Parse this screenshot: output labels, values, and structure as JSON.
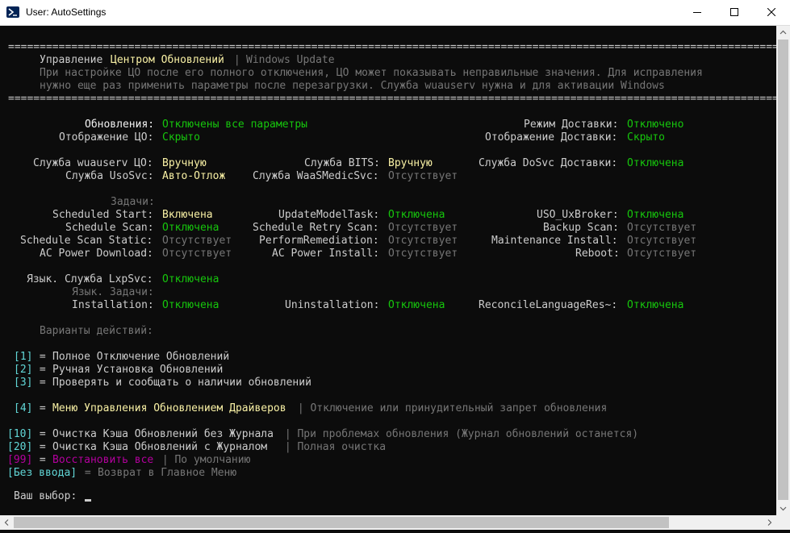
{
  "window": {
    "title": "User: AutoSettings",
    "app_icon": "powershell-icon"
  },
  "console": {
    "separator": "================================================================================================================================",
    "header": {
      "label_1": "Управление ",
      "label_2": "Центром Обновлений",
      "pipe": " | ",
      "label_3": "Windows Update",
      "note_1": "При настройке ЦО после его полного отключения, ЦО может показывать неправильные значения. Для исправления",
      "note_2": "нужно еще раз применить параметры после перезагрузки. Служба wuauserv нужна и для активации Windows"
    },
    "status": {
      "updates_label": "Обновления:",
      "updates_value": "Отключены все параметры",
      "delivery_mode_label": "Режим Доставки:",
      "delivery_mode_value": "Отключено",
      "display_label": "Отображение ЦО:",
      "display_value": "Скрыто",
      "delivery_display_label": "Отображение Доставки:",
      "delivery_display_value": "Скрыто"
    },
    "services": {
      "wuauserv_label": "Служба wuauserv ЦО:",
      "wuauserv_value": "Вручную",
      "bits_label": "Служба BITS:",
      "bits_value": "Вручную",
      "dosvc_label": "Служба DoSvc Доставки:",
      "dosvc_value": "Отключена",
      "usosvc_label": "Служба UsoSvc:",
      "usosvc_value": "Авто-Отлож",
      "waasmedic_label": "Служба WaaSMedicSvc:",
      "waasmedic_value": "Отсутствует"
    },
    "tasks": {
      "heading": "Задачи:",
      "items": [
        {
          "label": "Scheduled Start:",
          "value": "Включена"
        },
        {
          "label": "UpdateModelTask:",
          "value": "Отключена"
        },
        {
          "label": "USO_UxBroker:",
          "value": "Отключена"
        },
        {
          "label": "Schedule Scan:",
          "value": "Отключена"
        },
        {
          "label": "Schedule Retry Scan:",
          "value": "Отсутствует"
        },
        {
          "label": "Backup Scan:",
          "value": "Отсутствует"
        },
        {
          "label": "Schedule Scan Static:",
          "value": "Отсутствует"
        },
        {
          "label": "PerformRemediation:",
          "value": "Отсутствует"
        },
        {
          "label": "Maintenance Install:",
          "value": "Отсутствует"
        },
        {
          "label": "AC Power Download:",
          "value": "Отсутствует"
        },
        {
          "label": "AC Power Install:",
          "value": "Отсутствует"
        },
        {
          "label": "Reboot:",
          "value": "Отсутствует"
        }
      ]
    },
    "language": {
      "lxpsvc_label": "Язык. Служба LxpSvc:",
      "lxpsvc_value": "Отключена",
      "tasks_heading": "Язык. Задачи:",
      "installation_label": "Installation:",
      "installation_value": "Отключена",
      "uninstallation_label": "Uninstallation:",
      "uninstallation_value": "Отключена",
      "reconcile_label": "ReconcileLanguageRes~:",
      "reconcile_value": "Отключена"
    },
    "actions_heading": "Варианты действий:",
    "menu": [
      {
        "key": "[1]",
        "eq": " = ",
        "text": "Полное Отключение Обновлений",
        "hint": ""
      },
      {
        "key": "[2]",
        "eq": " = ",
        "text": "Ручная Установка Обновлений",
        "hint": ""
      },
      {
        "key": "[3]",
        "eq": " = ",
        "text": "Проверять и сообщать о наличии обновлений",
        "hint": ""
      },
      {
        "key": "[4]",
        "eq": " = ",
        "text": "Меню Управления Обновлением Драйверов",
        "hint": " | Отключение или принудительный запрет обновления"
      },
      {
        "key": "[10]",
        "eq": " = ",
        "text": "Очистка Кэша Обновлений без Журнала",
        "hint": " | При проблемах обновления (Журнал обновлений останется)"
      },
      {
        "key": "[20]",
        "eq": " = ",
        "text": "Очистка Кэша Обновлений с Журналом ",
        "hint": " | Полная очистка"
      },
      {
        "key": "[99]",
        "eq": " = ",
        "text": "Восстановить все",
        "hint": " | По умолчанию"
      },
      {
        "key": "[Без ввода]",
        "eq": " = ",
        "text": "Возврат в Главное Меню",
        "hint": ""
      }
    ],
    "prompt": "Ваш выбор:"
  },
  "colors": {
    "background": "#0c0c0c",
    "text": "#cccccc",
    "yellow": "#f9f1a5",
    "green": "#16c60c",
    "gray": "#767676",
    "cyan": "#61d6d6",
    "magenta": "#b4009e"
  }
}
